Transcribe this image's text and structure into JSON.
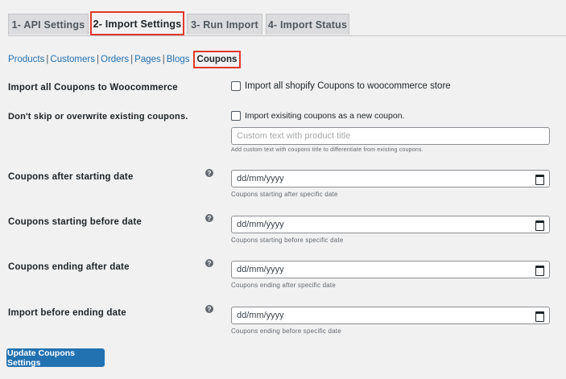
{
  "tabs": [
    {
      "label": "1- API Settings"
    },
    {
      "label": "2- Import Settings"
    },
    {
      "label": "3- Run Import"
    },
    {
      "label": "4- Import Status"
    }
  ],
  "subnav": {
    "products": "Products",
    "customers": "Customers",
    "orders": "Orders",
    "pages": "Pages",
    "blogs": "Blogs",
    "coupons": "Coupons",
    "separator": "|"
  },
  "settings": {
    "import_all_label": "Import all Coupons to Woocommerce",
    "import_all_checkbox": "Import all shopify Coupons to woocommerce store",
    "dont_skip_label": "Don't skip or overwrite existing coupons.",
    "dont_skip_checkbox": "Import exisiting coupons as a new coupon.",
    "custom_text_placeholder": "Custom text with product title",
    "custom_text_desc": "Add custom text with coupons title to differentiate from existing coupons.",
    "dates": [
      {
        "label": "Coupons after starting date",
        "value": "dd/mm/yyyy",
        "desc": "Coupons starting after specific date"
      },
      {
        "label": "Coupons starting before date",
        "value": "dd/mm/yyyy",
        "desc": "Coupons starting before specific date"
      },
      {
        "label": "Coupons ending after date",
        "value": "dd/mm/yyyy",
        "desc": "Coupons ending after specific date"
      },
      {
        "label": "Import before ending date",
        "value": "dd/mm/yyyy",
        "desc": "Coupons ending before specific date"
      }
    ],
    "help_glyph": "?"
  },
  "update_button": "Update Coupons Settings",
  "colors": {
    "accent": "#2271b1",
    "highlight": "#e0392c"
  }
}
